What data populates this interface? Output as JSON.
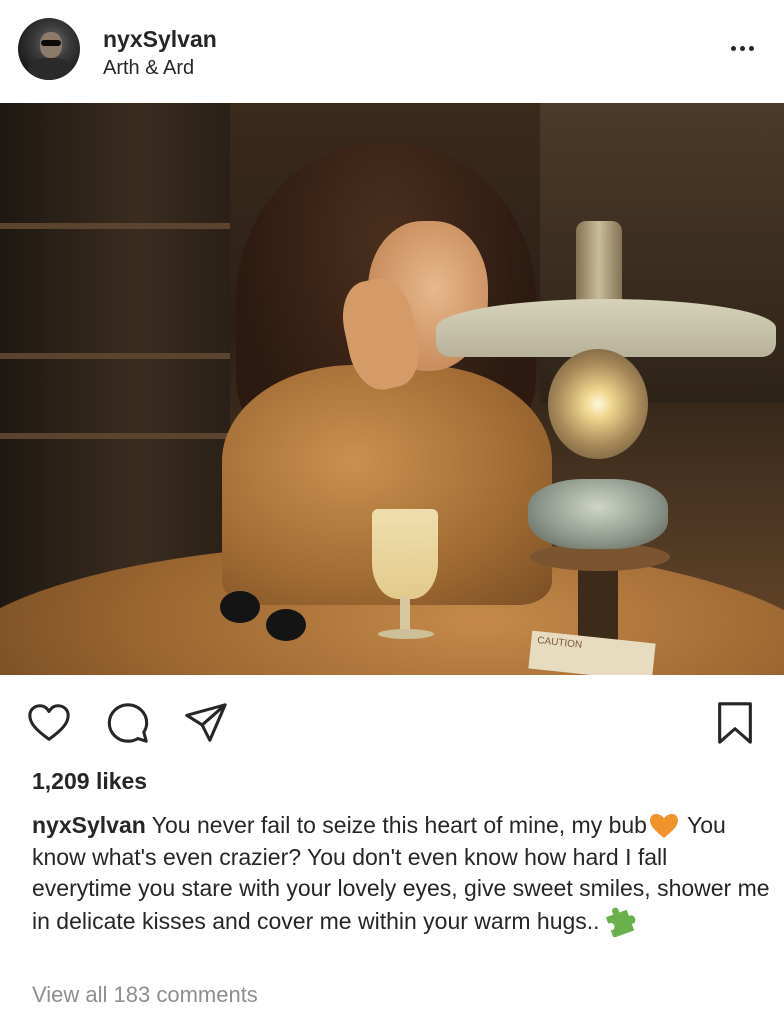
{
  "post": {
    "username": "nyxSylvan",
    "location": "Arth & Ard",
    "likes": "1,209 likes",
    "caption": {
      "username": "nyxSylvan",
      "text_part1": "You never fail to seize this heart of mine, my bub",
      "text_part2": " You know what's even crazier? You don't even know how hard I fall everytime you stare with your lovely eyes, give sweet smiles, shower me in delicate kisses and cover me within your warm hugs..",
      "emoji_1": "orange-heart",
      "emoji_2": "puzzle-piece"
    },
    "view_comments": "View all 183 comments",
    "photo_sign_text": "CAUTION"
  },
  "icons": {
    "more": "more-options-icon",
    "like": "heart-icon",
    "comment": "comment-icon",
    "share": "send-icon",
    "save": "bookmark-icon"
  },
  "colors": {
    "text": "#262626",
    "muted": "#8e8e8e",
    "heart_emoji": "#f0932b",
    "puzzle_emoji": "#6ab04c"
  }
}
